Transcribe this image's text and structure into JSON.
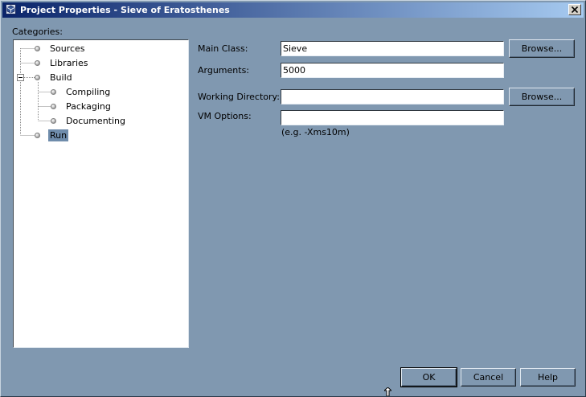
{
  "window": {
    "title": "Project Properties - Sieve of Eratosthenes",
    "close_symbol": "×"
  },
  "categories": {
    "label": "Categories:",
    "items": [
      {
        "label": "Sources",
        "icon": "node-icon"
      },
      {
        "label": "Libraries",
        "icon": "node-icon"
      },
      {
        "label": "Build",
        "icon": "node-icon",
        "expanded": true
      },
      {
        "label": "Compiling",
        "icon": "node-icon"
      },
      {
        "label": "Packaging",
        "icon": "node-icon"
      },
      {
        "label": "Documenting",
        "icon": "node-icon"
      },
      {
        "label": "Run",
        "icon": "node-icon",
        "selected": true
      }
    ]
  },
  "run": {
    "main_class": {
      "label": "Main Class:",
      "value": "Sieve",
      "browse": "Browse..."
    },
    "arguments": {
      "label": "Arguments:",
      "value": "5000"
    },
    "working_directory": {
      "label": "Working Directory:",
      "value": "",
      "browse": "Browse..."
    },
    "vm_options": {
      "label": "VM Options:",
      "value": "",
      "hint": "(e.g. -Xms10m)"
    }
  },
  "buttons": {
    "ok": "OK",
    "cancel": "Cancel",
    "help": "Help"
  },
  "colors": {
    "background": "#8098b0",
    "selection": "#6f8cab",
    "title_gradient_start": "#0a246a"
  }
}
